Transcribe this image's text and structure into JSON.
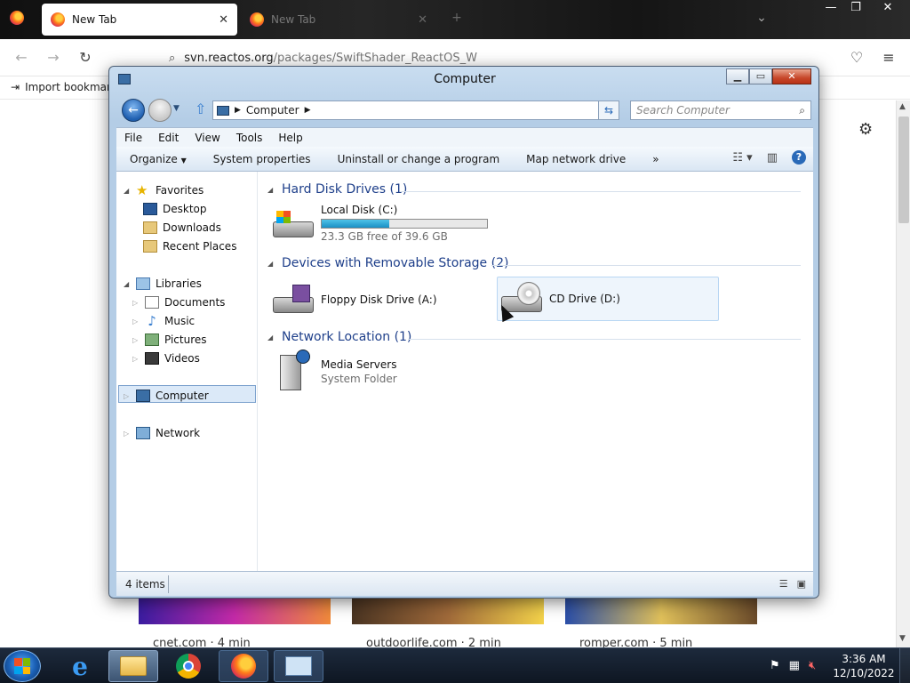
{
  "browser": {
    "tabs": [
      {
        "label": "New Tab",
        "active": true
      },
      {
        "label": "New Tab",
        "active": false
      }
    ],
    "new_tab_icon": "plus-icon",
    "url_host": "svn.reactos.org",
    "url_path": "/packages/SwiftShader_ReactOS_W",
    "bookmark": "Import bookmarks...",
    "cards": [
      {
        "label": "cnet.com · 4 min"
      },
      {
        "label": "outdoorlife.com · 2 min"
      },
      {
        "label": "romper.com · 5 min"
      }
    ]
  },
  "explorer": {
    "title": "Computer",
    "address": "Computer",
    "search_placeholder": "Search Computer",
    "menu": [
      "File",
      "Edit",
      "View",
      "Tools",
      "Help"
    ],
    "commands": {
      "organize": "Organize",
      "system_properties": "System properties",
      "uninstall": "Uninstall or change a program",
      "map_drive": "Map network drive",
      "more": "»"
    },
    "nav": {
      "favorites": "Favorites",
      "desktop": "Desktop",
      "downloads": "Downloads",
      "recent": "Recent Places",
      "libraries": "Libraries",
      "documents": "Documents",
      "music": "Music",
      "pictures": "Pictures",
      "videos": "Videos",
      "computer": "Computer",
      "network": "Network"
    },
    "groups": {
      "hdd": {
        "header": "Hard Disk Drives (1)",
        "items": [
          {
            "name": "Local Disk (C:)",
            "free": "23.3 GB free of 39.6 GB",
            "used_fraction": 0.41
          }
        ]
      },
      "removable": {
        "header": "Devices with Removable Storage (2)",
        "items": [
          {
            "name": "Floppy Disk Drive (A:)"
          },
          {
            "name": "CD Drive (D:)"
          }
        ]
      },
      "network": {
        "header": "Network Location (1)",
        "items": [
          {
            "name": "Media Servers",
            "sub": "System Folder"
          }
        ]
      }
    },
    "status": "4 items"
  },
  "taskbar": {
    "time": "3:36 AM",
    "date": "12/10/2022"
  },
  "colors": {
    "accent": "#1e3f8a",
    "selection": "#dbe9f8",
    "capacity": "#1a8fc4"
  }
}
